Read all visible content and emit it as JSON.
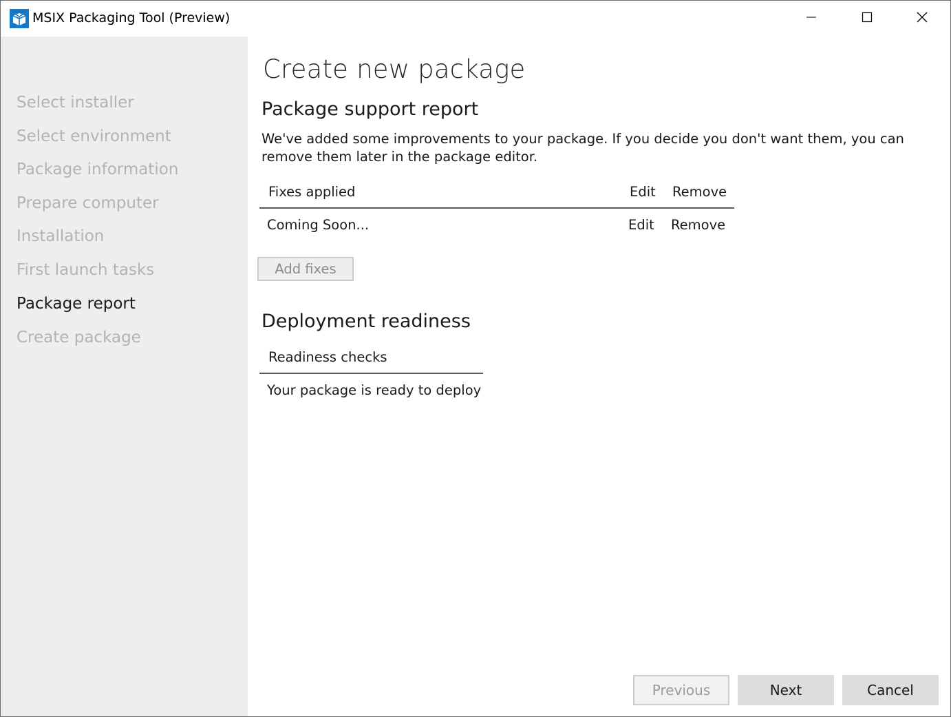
{
  "window": {
    "title": "MSIX Packaging Tool (Preview)",
    "icon": "msix-package-icon",
    "controls": [
      "minimize-icon",
      "maximize-icon",
      "close-icon"
    ]
  },
  "sidebar": {
    "steps": [
      {
        "label": "Select installer",
        "state": "disabled"
      },
      {
        "label": "Select environment",
        "state": "disabled"
      },
      {
        "label": "Package information",
        "state": "disabled"
      },
      {
        "label": "Prepare computer",
        "state": "disabled"
      },
      {
        "label": "Installation",
        "state": "disabled"
      },
      {
        "label": "First launch tasks",
        "state": "disabled"
      },
      {
        "label": "Package report",
        "state": "active"
      },
      {
        "label": "Create package",
        "state": "disabled"
      }
    ]
  },
  "main": {
    "page_title": "Create new package",
    "support_report": {
      "title": "Package support report",
      "description": "We've added some improvements to your package. If you decide you don't want them, you can remove them later in the package editor.",
      "table": {
        "headers": [
          "Fixes applied",
          "Edit",
          "Remove"
        ],
        "rows": [
          {
            "name": "Coming Soon...",
            "edit": "Edit",
            "remove": "Remove"
          }
        ]
      },
      "add_fixes_label": "Add fixes"
    },
    "deployment": {
      "title": "Deployment readiness",
      "table": {
        "header": "Readiness checks",
        "rows": [
          "Your package is ready to deploy"
        ]
      }
    }
  },
  "footer": {
    "previous_label": "Previous",
    "next_label": "Next",
    "cancel_label": "Cancel"
  },
  "colors": {
    "sidebar_bg": "#eeeeee",
    "inactive_step": "#b3b3b3",
    "active_step": "#1a1a1a",
    "button_bg": "#dddddd",
    "app_icon_blue": "#1479c9"
  }
}
